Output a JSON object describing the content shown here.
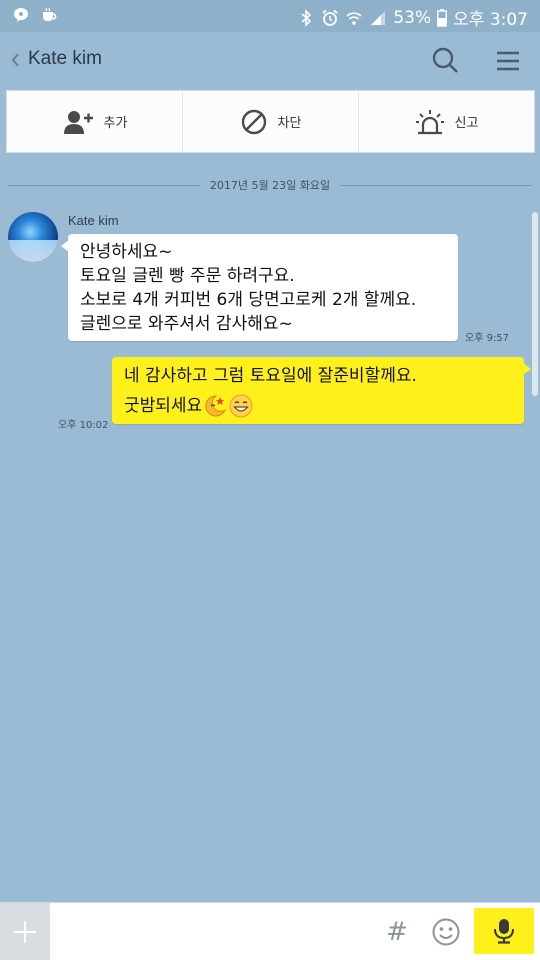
{
  "status_bar": {
    "battery": "53%",
    "time": "오후 3:07"
  },
  "header": {
    "back_icon": "chevron-left-icon",
    "title": "Kate kim",
    "search_icon": "search-icon",
    "menu_icon": "hamburger-menu-icon"
  },
  "actions": [
    {
      "label": "추가",
      "icon": "add-friend-icon"
    },
    {
      "label": "차단",
      "icon": "block-icon"
    },
    {
      "label": "신고",
      "icon": "report-alarm-icon"
    }
  ],
  "date_divider": "2017년 5월 23일 화요일",
  "messages": [
    {
      "direction": "incoming",
      "sender": "Kate kim",
      "lines": [
        "안녕하세요~",
        "토요일 글렌 빵 주문 하려구요.",
        "소보로 4개 커피번 6개 당면고로케 2개 할께요.",
        "글렌으로 와주셔서 감사해요~"
      ],
      "time": "오후 9:57"
    },
    {
      "direction": "outgoing",
      "lines": [
        "네 감사하고 그럼 토요일에 잘준비할께요.",
        "굿밤되세요"
      ],
      "emoticons": [
        "crescent-moon-star-emoji",
        "grinning-face-emoji"
      ],
      "time": "오후 10:02"
    }
  ],
  "input": {
    "placeholder": "",
    "hash_label": "#",
    "plus_icon": "plus-icon",
    "emoticon_icon": "smiley-icon",
    "mic_icon": "microphone-icon"
  },
  "colors": {
    "chat_background": "#9bbbd4",
    "outgoing_bubble": "#fef01b",
    "incoming_bubble": "#ffffff"
  }
}
